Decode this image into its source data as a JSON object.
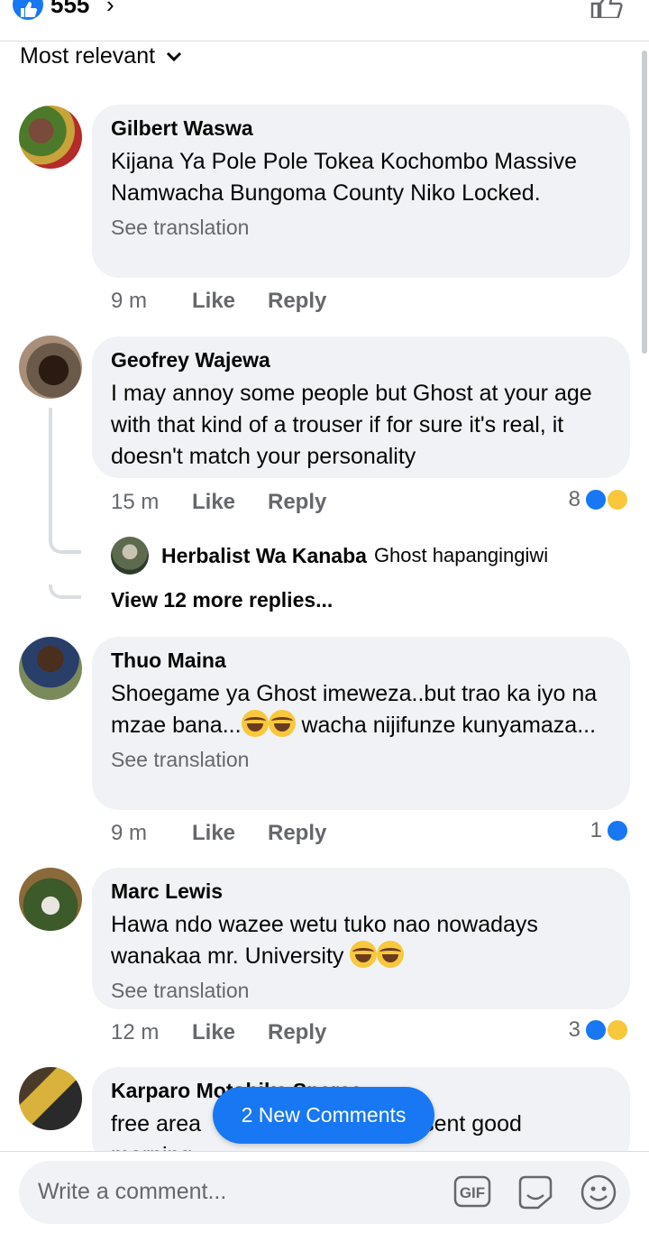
{
  "header": {
    "reaction_count": "555",
    "chevron": "›"
  },
  "sort": {
    "label": "Most relevant"
  },
  "comments": [
    {
      "name": "Gilbert Waswa",
      "text": "Kijana Ya Pole Pole Tokea Kochombo Massive Namwacha Bungoma County Niko Locked.",
      "see_translation": "See translation",
      "time": "9 m",
      "like": "Like",
      "reply": "Reply"
    },
    {
      "name": "Geofrey Wajewa",
      "text": "I may annoy some people but Ghost at your age with that kind of a trouser if for sure it's real, it doesn't match your personality",
      "time": "15 m",
      "like": "Like",
      "reply": "Reply",
      "reactions": "8",
      "reply_preview": {
        "name": "Herbalist Wa Kanaba",
        "text": "Ghost hapangingiwi"
      },
      "view_more": "View 12 more replies..."
    },
    {
      "name": "Thuo Maina",
      "text_a": "Shoegame ya Ghost imeweza..but trao ka iyo na mzae bana...",
      "text_b": " wacha nijifunze kunyamaza...",
      "see_translation": "See translation",
      "time": "9 m",
      "like": "Like",
      "reply": "Reply",
      "reactions": "1"
    },
    {
      "name": "Marc Lewis",
      "text": "Hawa ndo wazee wetu tuko nao nowadays wanakaa mr. University",
      "see_translation": "See translation",
      "time": "12 m",
      "like": "Like",
      "reply": "Reply",
      "reactions": "3"
    },
    {
      "name": "Karparo Motobike Spares",
      "text_left": "free area",
      "text_right": "sent good",
      "text_cut": "morning"
    }
  ],
  "new_comments": "2 New Comments",
  "composer": {
    "placeholder": "Write a comment...",
    "gif": "GIF"
  },
  "colors": {
    "accent": "#1877f2",
    "bubble": "#f0f2f5",
    "muted": "#65676b"
  },
  "icons": [
    "like-icon",
    "chevron-down-icon",
    "thumb-up-outline-icon",
    "gif-icon",
    "sticker-icon",
    "emoji-icon",
    "laugh-emoji-icon"
  ]
}
